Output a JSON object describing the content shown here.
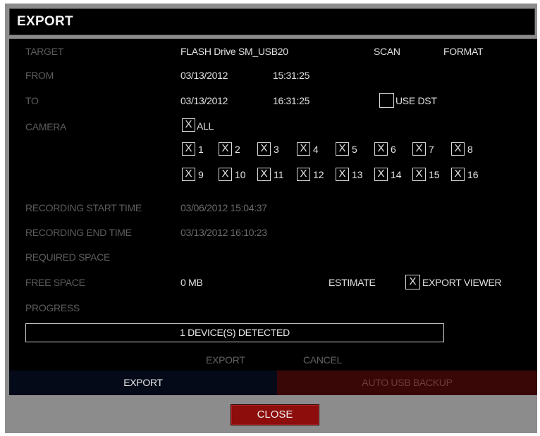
{
  "title": "EXPORT",
  "fields": {
    "target_label": "TARGET",
    "target_value": "FLASH Drive SM_USB20",
    "scan_label": "SCAN",
    "format_label": "FORMAT",
    "from_label": "FROM",
    "from_date": "03/13/2012",
    "from_time": "15:31:25",
    "to_label": "TO",
    "to_date": "03/13/2012",
    "to_time": "16:31:25",
    "use_dst_label": "USE DST",
    "use_dst_checked": false,
    "camera_label": "CAMERA",
    "all_label": "ALL",
    "all_checked": true,
    "rec_start_label": "RECORDING START TIME",
    "rec_start_value": "03/06/2012 15:04:37",
    "rec_end_label": "RECORDING END TIME",
    "rec_end_value": "03/13/2012 16:10:23",
    "required_space_label": "REQUIRED SPACE",
    "free_space_label": "FREE SPACE",
    "free_space_value": "0 MB",
    "estimate_label": "ESTIMATE",
    "export_viewer_label": "EXPORT VIEWER",
    "export_viewer_checked": true,
    "progress_label": "PROGRESS",
    "progress_text": "1 DEVICE(S) DETECTED"
  },
  "check_mark": "X",
  "cameras": [
    "1",
    "2",
    "3",
    "4",
    "5",
    "6",
    "7",
    "8",
    "9",
    "10",
    "11",
    "12",
    "13",
    "14",
    "15",
    "16"
  ],
  "actions": {
    "export_label": "EXPORT",
    "cancel_label": "CANCEL"
  },
  "tabs": [
    {
      "label": "EXPORT",
      "active": true
    },
    {
      "label": "AUTO USB BACKUP",
      "active": false
    }
  ],
  "close_label": "CLOSE",
  "colors": {
    "label_dim": "#5c5c5c",
    "value": "#e0e0e0",
    "close_red": "#8d0c0c",
    "inactive_tab": "#3a0707",
    "active_tab": "#050a18"
  }
}
